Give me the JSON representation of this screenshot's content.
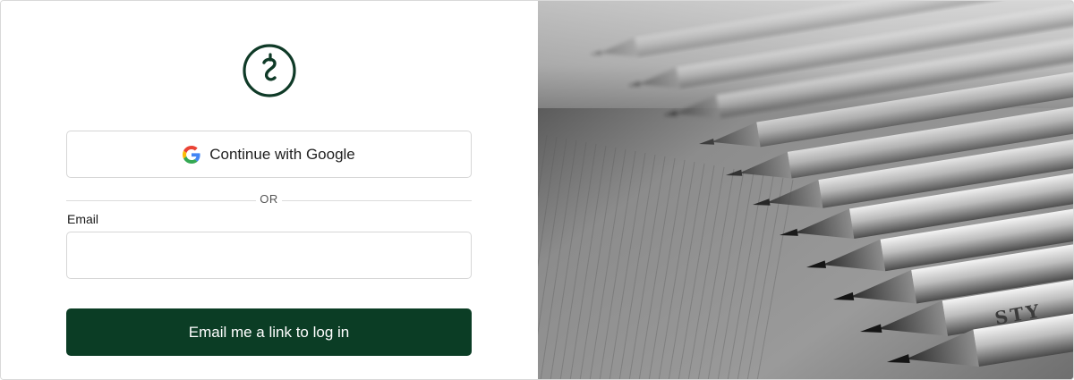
{
  "logo": {
    "icon": "brand-logo-icon",
    "color": "#0f3a27"
  },
  "google": {
    "label": "Continue with Google",
    "icon": "google-icon"
  },
  "divider": {
    "text": "OR"
  },
  "email": {
    "label": "Email",
    "value": "",
    "placeholder": ""
  },
  "submit": {
    "label": "Email me a link to log in",
    "color": "#0b3d25"
  },
  "hero": {
    "subject": "pencils-photo",
    "pencil_text": "STY"
  }
}
